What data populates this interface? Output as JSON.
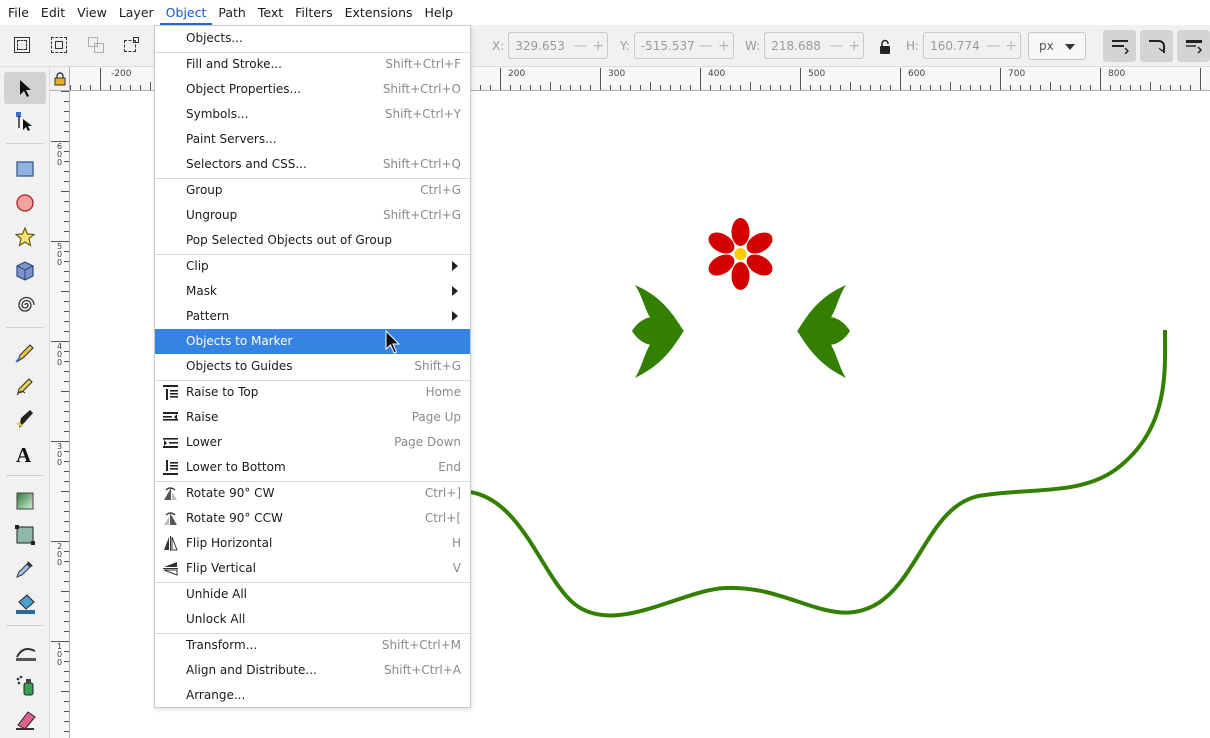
{
  "menubar": [
    "File",
    "Edit",
    "View",
    "Layer",
    "Object",
    "Path",
    "Text",
    "Filters",
    "Extensions",
    "Help"
  ],
  "active_menu": "Object",
  "toolbar": {
    "x_label": "X:",
    "x_value": "329.653",
    "y_label": "Y:",
    "y_value": "-515.537",
    "w_label": "W:",
    "w_value": "218.688",
    "h_label": "H:",
    "h_value": "160.774",
    "unit": "px"
  },
  "ruler": {
    "h_labels": [
      "-200",
      "200",
      "300",
      "400",
      "500",
      "600",
      "700",
      "800"
    ],
    "v_labels": [
      "6\n0\n0",
      "5\n0\n0",
      "4\n0\n0",
      "3\n0\n0",
      "2\n0\n0",
      "1\n0\n0"
    ]
  },
  "object_menu": [
    {
      "label": "Objects...",
      "shortcut": "",
      "icon": ""
    },
    {
      "label": "Fill and Stroke...",
      "shortcut": "Shift+Ctrl+F",
      "icon": ""
    },
    {
      "label": "Object Properties...",
      "shortcut": "Shift+Ctrl+O",
      "icon": ""
    },
    {
      "label": "Symbols...",
      "shortcut": "Shift+Ctrl+Y",
      "icon": ""
    },
    {
      "label": "Paint Servers...",
      "shortcut": "",
      "icon": ""
    },
    {
      "label": "Selectors and CSS...",
      "shortcut": "Shift+Ctrl+Q",
      "icon": ""
    },
    {
      "label": "Group",
      "shortcut": "Ctrl+G",
      "icon": ""
    },
    {
      "label": "Ungroup",
      "shortcut": "Shift+Ctrl+G",
      "icon": ""
    },
    {
      "label": "Pop Selected Objects out of Group",
      "shortcut": "",
      "icon": ""
    },
    {
      "label": "Clip",
      "shortcut": "",
      "icon": "",
      "submenu": true
    },
    {
      "label": "Mask",
      "shortcut": "",
      "icon": "",
      "submenu": true
    },
    {
      "label": "Pattern",
      "shortcut": "",
      "icon": "",
      "submenu": true
    },
    {
      "label": "Objects to Marker",
      "shortcut": "",
      "icon": "",
      "highlighted": true
    },
    {
      "label": "Objects to Guides",
      "shortcut": "Shift+G",
      "icon": ""
    },
    {
      "label": "Raise to Top",
      "shortcut": "Home",
      "icon": "raise-top-icon"
    },
    {
      "label": "Raise",
      "shortcut": "Page Up",
      "icon": "raise-icon"
    },
    {
      "label": "Lower",
      "shortcut": "Page Down",
      "icon": "lower-icon"
    },
    {
      "label": "Lower to Bottom",
      "shortcut": "End",
      "icon": "lower-bottom-icon"
    },
    {
      "label": "Rotate 90° CW",
      "shortcut": "Ctrl+]",
      "icon": "rotate-cw-icon"
    },
    {
      "label": "Rotate 90° CCW",
      "shortcut": "Ctrl+[",
      "icon": "rotate-ccw-icon"
    },
    {
      "label": "Flip Horizontal",
      "shortcut": "H",
      "icon": "flip-horizontal-icon"
    },
    {
      "label": "Flip Vertical",
      "shortcut": "V",
      "icon": "flip-vertical-icon"
    },
    {
      "label": "Unhide All",
      "shortcut": "",
      "icon": ""
    },
    {
      "label": "Unlock All",
      "shortcut": "",
      "icon": ""
    },
    {
      "label": "Transform...",
      "shortcut": "Shift+Ctrl+M",
      "icon": ""
    },
    {
      "label": "Align and Distribute...",
      "shortcut": "Shift+Ctrl+A",
      "icon": ""
    },
    {
      "label": "Arrange...",
      "shortcut": "",
      "icon": ""
    }
  ],
  "colors": {
    "accent": "#3584e4",
    "flower_petal": "#d40000",
    "flower_center": "#ffcc00",
    "leaf": "#338000",
    "stem": "#338000"
  }
}
